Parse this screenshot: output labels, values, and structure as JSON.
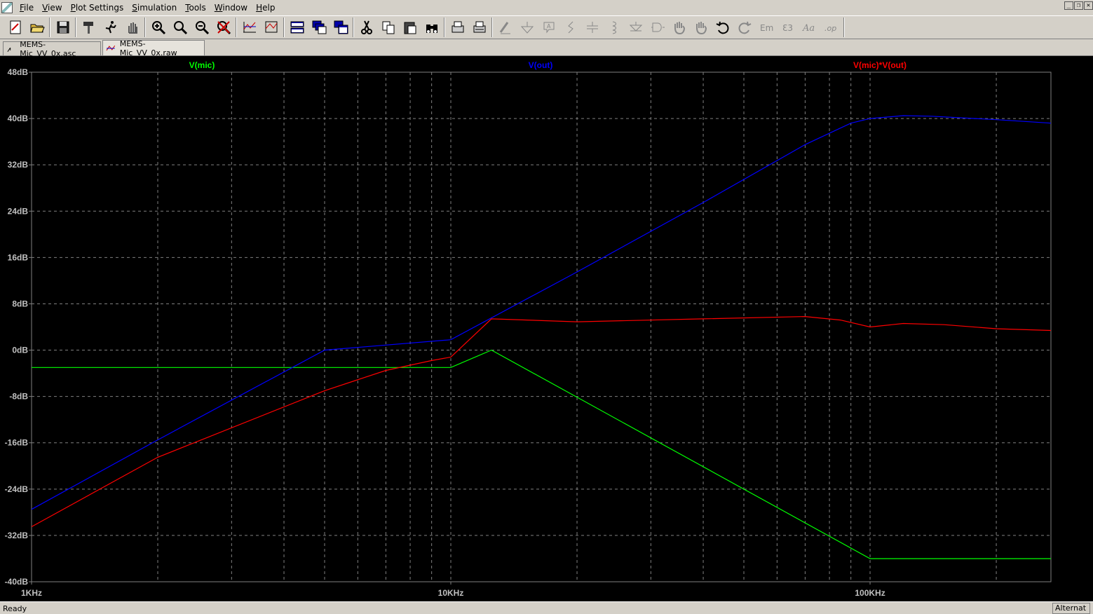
{
  "menu": {
    "items": [
      "File",
      "View",
      "Plot Settings",
      "Simulation",
      "Tools",
      "Window",
      "Help"
    ],
    "underline": [
      "F",
      "V",
      "P",
      "S",
      "T",
      "W",
      "H"
    ]
  },
  "toolbar": {
    "buttons": [
      {
        "icon": "new-schematic-icon"
      },
      {
        "icon": "open-folder-icon"
      },
      {
        "sep": true
      },
      {
        "icon": "save-icon"
      },
      {
        "sep": true
      },
      {
        "icon": "control-panel-hammer-icon"
      },
      {
        "icon": "run-simulation-icon"
      },
      {
        "icon": "halt-hand-icon"
      },
      {
        "sep": true
      },
      {
        "icon": "zoom-in-icon"
      },
      {
        "icon": "zoom-area-icon"
      },
      {
        "icon": "zoom-out-icon"
      },
      {
        "icon": "zoom-cancel-icon"
      },
      {
        "sep": true
      },
      {
        "icon": "autorange-icon"
      },
      {
        "icon": "manual-limits-icon"
      },
      {
        "sep": true
      },
      {
        "icon": "tile-horizontal-icon"
      },
      {
        "icon": "cascade-icon"
      },
      {
        "icon": "tile-vertical-icon"
      },
      {
        "sep": true
      },
      {
        "icon": "cut-scissors-icon"
      },
      {
        "icon": "copy-icon"
      },
      {
        "icon": "paste-icon"
      },
      {
        "icon": "find-binoculars-icon"
      },
      {
        "sep": true
      },
      {
        "icon": "print-icon"
      },
      {
        "icon": "print-setup-icon"
      },
      {
        "sep": true
      },
      {
        "icon": "draw-wire-icon"
      },
      {
        "icon": "ground-icon"
      },
      {
        "icon": "label-net-icon"
      },
      {
        "icon": "resistor-icon"
      },
      {
        "icon": "capacitor-icon"
      },
      {
        "icon": "inductor-icon"
      },
      {
        "icon": "diode-icon"
      },
      {
        "icon": "component-icon"
      },
      {
        "icon": "move-hand-icon"
      },
      {
        "icon": "drag-hand-icon"
      },
      {
        "icon": "undo-icon"
      },
      {
        "icon": "redo-icon"
      },
      {
        "icon": "rotate-icon"
      },
      {
        "icon": "mirror-icon"
      },
      {
        "icon": "text-icon"
      },
      {
        "icon": "spice-directive-icon"
      },
      {
        "sep": true
      }
    ]
  },
  "tabs": [
    {
      "label": "MEMS-Mic_VV_0x.asc",
      "icon": "schematic-icon",
      "active": false
    },
    {
      "label": "MEMS-Mic_VV_0x.raw",
      "icon": "waveform-icon",
      "active": true
    }
  ],
  "status": {
    "left": "Ready",
    "right": "Alternat"
  },
  "colors": {
    "v_mic": "#00ff00",
    "v_out": "#0000ff",
    "v_product": "#ff0000",
    "grid": "#808080",
    "axis_text": "#c0c0c0",
    "background": "#000000"
  },
  "chart_data": {
    "type": "line",
    "x_scale": "log",
    "xlim": [
      1000,
      270000
    ],
    "ylim": [
      -40,
      48
    ],
    "x_ticks": [
      {
        "value": 1000,
        "label": "1KHz"
      },
      {
        "value": 10000,
        "label": "10KHz"
      },
      {
        "value": 100000,
        "label": "100KHz"
      }
    ],
    "y_ticks": [
      {
        "value": 48,
        "label": "48dB"
      },
      {
        "value": 40,
        "label": "40dB"
      },
      {
        "value": 32,
        "label": "32dB"
      },
      {
        "value": 24,
        "label": "24dB"
      },
      {
        "value": 16,
        "label": "16dB"
      },
      {
        "value": 8,
        "label": "8dB"
      },
      {
        "value": 0,
        "label": "0dB"
      },
      {
        "value": -8,
        "label": "-8dB"
      },
      {
        "value": -16,
        "label": "-16dB"
      },
      {
        "value": -24,
        "label": "-24dB"
      },
      {
        "value": -32,
        "label": "-32dB"
      },
      {
        "value": -40,
        "label": "-40dB"
      }
    ],
    "grid": true,
    "series": [
      {
        "name": "V(mic)",
        "color": "#00ff00",
        "x": [
          1000,
          10000,
          12500,
          100000,
          270000
        ],
        "y": [
          -3,
          -3,
          0,
          -36,
          -36
        ]
      },
      {
        "name": "V(out)",
        "color": "#0000ff",
        "x": [
          1000,
          2000,
          5000,
          10000,
          20000,
          40000,
          70000,
          90000,
          100000,
          120000,
          140000,
          200000,
          270000
        ],
        "y": [
          -27.5,
          -15.5,
          0,
          1.8,
          13.5,
          25.5,
          35.5,
          39.2,
          40.0,
          40.5,
          40.4,
          39.8,
          39.2
        ]
      },
      {
        "name": "V(mic)*V(out)",
        "color": "#ff0000",
        "x": [
          1000,
          2000,
          5000,
          7000,
          9000,
          10000,
          12500,
          20000,
          40000,
          70000,
          85000,
          100000,
          120000,
          150000,
          200000,
          270000
        ],
        "y": [
          -30.5,
          -18.5,
          -7,
          -3.5,
          -1.8,
          -1.2,
          5.4,
          4.9,
          5.4,
          5.8,
          5.2,
          4.0,
          4.6,
          4.4,
          3.7,
          3.4
        ]
      }
    ]
  }
}
